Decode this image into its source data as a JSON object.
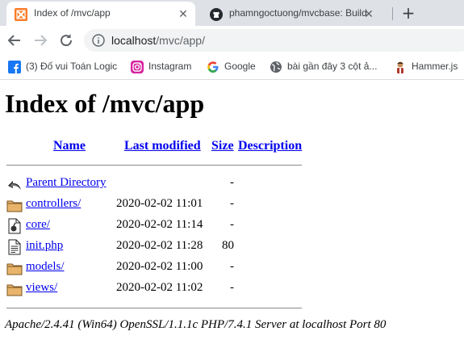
{
  "browser": {
    "tabs": [
      {
        "title": "Index of /mvc/app",
        "close": "✕",
        "favicon": "xampp-icon",
        "active": true
      },
      {
        "title": "phamngoctuong/mvcbase: Build",
        "close": "✕",
        "favicon": "github-icon",
        "active": false
      }
    ],
    "new_tab": "+",
    "address": {
      "host": "localhost",
      "path": "/mvc/app/"
    },
    "bookmarks": [
      {
        "label": "(3) Đố vui Toán Logic",
        "icon": "facebook-icon"
      },
      {
        "label": "Instagram",
        "icon": "instagram-icon"
      },
      {
        "label": "Google",
        "icon": "google-icon"
      },
      {
        "label": "bài gần đây 3 cột ả...",
        "icon": "globe-icon"
      },
      {
        "label": "Hammer.js",
        "icon": "hammer-icon"
      }
    ]
  },
  "page": {
    "title": "Index of /mvc/app",
    "columns": {
      "name": "Name",
      "last_modified": "Last modified",
      "size": "Size",
      "description": "Description"
    },
    "rows": [
      {
        "name": "Parent Directory",
        "modified": "",
        "size": "-",
        "icon": "back-arrow-icon"
      },
      {
        "name": "controllers/",
        "modified": "2020-02-02 11:01",
        "size": "-",
        "icon": "folder-icon"
      },
      {
        "name": "core/",
        "modified": "2020-02-02 11:14",
        "size": "-",
        "icon": "unknown-file-icon"
      },
      {
        "name": "init.php",
        "modified": "2020-02-02 11:28",
        "size": "80",
        "icon": "text-file-icon"
      },
      {
        "name": "models/",
        "modified": "2020-02-02 11:00",
        "size": "-",
        "icon": "folder-icon"
      },
      {
        "name": "views/",
        "modified": "2020-02-02 11:02",
        "size": "-",
        "icon": "folder-icon"
      }
    ],
    "server_signature": "Apache/2.4.41 (Win64) OpenSSL/1.1.1c PHP/7.4.1 Server at localhost Port 80"
  }
}
